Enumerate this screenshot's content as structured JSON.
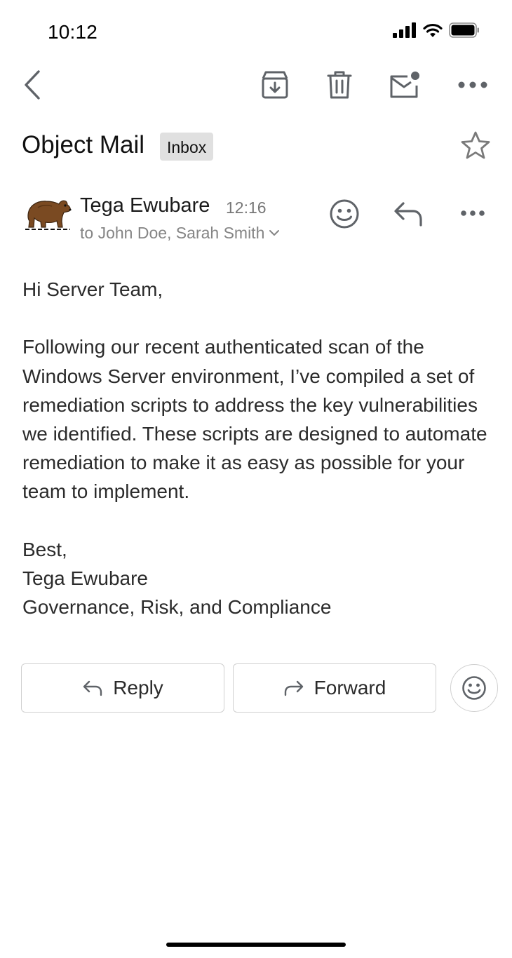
{
  "status_bar": {
    "time": "10:12"
  },
  "toolbar": {
    "icons": [
      "back-icon",
      "archive-icon",
      "trash-icon",
      "mark-unread-icon",
      "more-icon"
    ]
  },
  "subject": {
    "title": "Object Mail",
    "label": "Inbox"
  },
  "sender": {
    "name": "Tega Ewubare",
    "time": "12:16",
    "recipients": "to John Doe, Sarah Smith"
  },
  "body": {
    "greeting": "Hi Server Team,",
    "paragraph": "Following our recent authenticated scan of the Windows Server environment, I’ve compiled a set of remediation scripts to address the key vulnerabilities we identified. These scripts are designed to automate remediation to make it as easy as possible for your team to implement.",
    "signoff": "Best,",
    "signature_name": "Tega Ewubare",
    "signature_dept": "Governance, Risk, and Compliance"
  },
  "actions": {
    "reply_label": "Reply",
    "forward_label": "Forward"
  },
  "colors": {
    "badge_bg": "#e0e0e0",
    "icon_gray": "#5f6368",
    "text_main": "#2b2b2b",
    "text_secondary": "#858585"
  }
}
